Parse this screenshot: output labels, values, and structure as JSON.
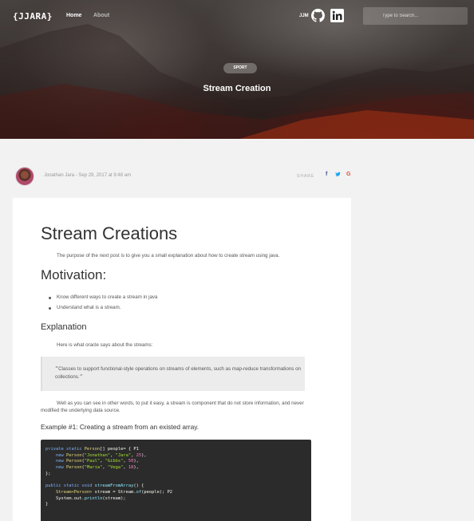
{
  "nav": {
    "logo": "{JJARA}",
    "home": "Home",
    "about": "About",
    "initials": "JJM",
    "search_placeholder": "Type to Search..."
  },
  "hero": {
    "tag": "SPORT",
    "title": "Stream Creation"
  },
  "author": {
    "meta": "Jonathan Jara  - Sep 29, 2017 at 9:48 am",
    "share_label": "SHARE",
    "share_icons": [
      "facebook-icon",
      "twitter-icon",
      "google-plus-icon"
    ],
    "share_glyphs": [
      "f",
      "t",
      "G"
    ],
    "share_colors": [
      "#3b5998",
      "#1da1f2",
      "#dd4b39"
    ]
  },
  "article": {
    "title": "Stream Creations",
    "intro": "The purpose of the next post is to give you a small explanation about how to create stream using java.",
    "motivation_heading": "Motivation:",
    "motivation_items": [
      "Know different ways to create a stream in java",
      "Understand what is a stream."
    ],
    "explanation_heading": "Explanation",
    "explanation_text": "Here is what oracle says about the streams:",
    "quote": "Classes to support functional-style operations on streams of elements, such as map-reduce transformations on collections.",
    "paragraph": "Well as you can see in other words, to put it easy, a stream is component that do not store information, and never modified the underlying data source.",
    "example_heading": "Example #1: Creating a stream from an existed array.",
    "code_lines": [
      "private static Person[] people= { P1",
      "    new Person(\"Jonathan\", \"Jara\", 25),",
      "    new Person(\"Paul\", \"Gibbs\", 50),",
      "    new Person(\"Maria\", \"Vega\", 18),",
      "};",
      "",
      "public static void streamFromArray() {",
      "    Stream<Person> stream = Stream.of(people); P2",
      "    System.out.println(stream);",
      "}"
    ]
  },
  "colors": {
    "page_bg": "#f2f2f2",
    "card_bg": "#ffffff",
    "code_bg": "#2b2b2b"
  }
}
